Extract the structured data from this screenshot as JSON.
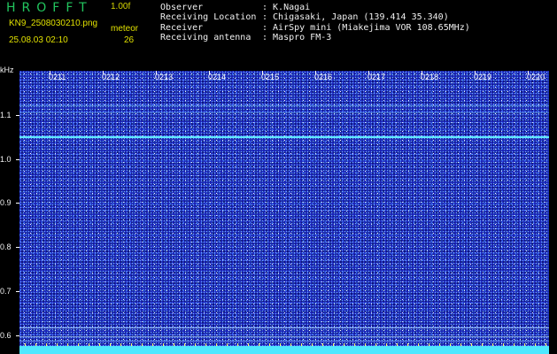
{
  "header": {
    "app_title": "HROFFT",
    "version": "1.00f",
    "filename": "KN9_2508030210.png",
    "datetime": "25.08.03 02:10",
    "meteor_label": "meteor",
    "meteor_count": "26"
  },
  "info": [
    {
      "key": "Observer",
      "value": ": K.Nagai"
    },
    {
      "key": "Receiving Location",
      "value": ": Chigasaki, Japan (139.414 35.340)"
    },
    {
      "key": "Receiver",
      "value": ": AirSpy mini (Miakejima VOR 108.65MHz)"
    },
    {
      "key": "Receiving antenna",
      "value": ": Maspro FM-3"
    }
  ],
  "axis": {
    "y_unit": "kHz",
    "y_ticks": [
      "1.1",
      "1.0",
      "0.9",
      "0.8",
      "0.7",
      "0.6"
    ],
    "x_ticks": [
      "0211",
      "0212",
      "0213",
      "0214",
      "0215",
      "0216",
      "0217",
      "0218",
      "0219",
      "0220"
    ]
  },
  "colors": {
    "background": "#000000",
    "spectrogram": "#1a22b8",
    "title": "#22c55e",
    "meta": "#e0e000",
    "signal_line": "#5fe8ff",
    "bottom_bar": "#4ee8ff"
  },
  "signals_khz": [
    1.12,
    1.105,
    1.05,
    0.62,
    0.6
  ]
}
